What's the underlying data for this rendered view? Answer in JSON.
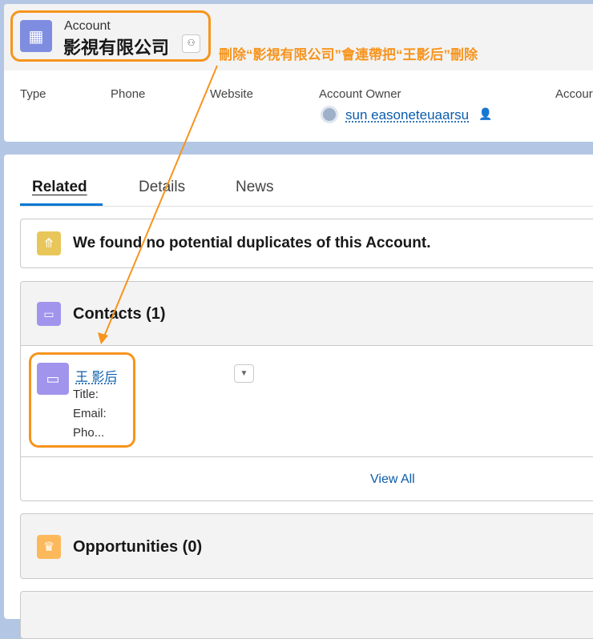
{
  "header": {
    "object_type": "Account",
    "name": "影視有限公司",
    "fields": [
      {
        "label": "Type"
      },
      {
        "label": "Phone"
      },
      {
        "label": "Website"
      },
      {
        "label": "Account Owner",
        "value": "sun easoneteuaarsu"
      },
      {
        "label": "Accour"
      }
    ]
  },
  "annotation": {
    "text": "刪除“影視有限公司”會連帶把“王影后”刪除",
    "color": "#f7941d"
  },
  "tabs": [
    {
      "label": "Related",
      "active": true
    },
    {
      "label": "Details"
    },
    {
      "label": "News"
    }
  ],
  "duplicates": {
    "text": "We found no potential duplicates of this Account."
  },
  "contacts": {
    "title": "Contacts (1)",
    "items": [
      {
        "name": "王 影后",
        "fields": [
          "Title:",
          "Email:",
          "Pho..."
        ]
      }
    ],
    "view_all": "View All"
  },
  "opportunities": {
    "title": "Opportunities (0)"
  }
}
